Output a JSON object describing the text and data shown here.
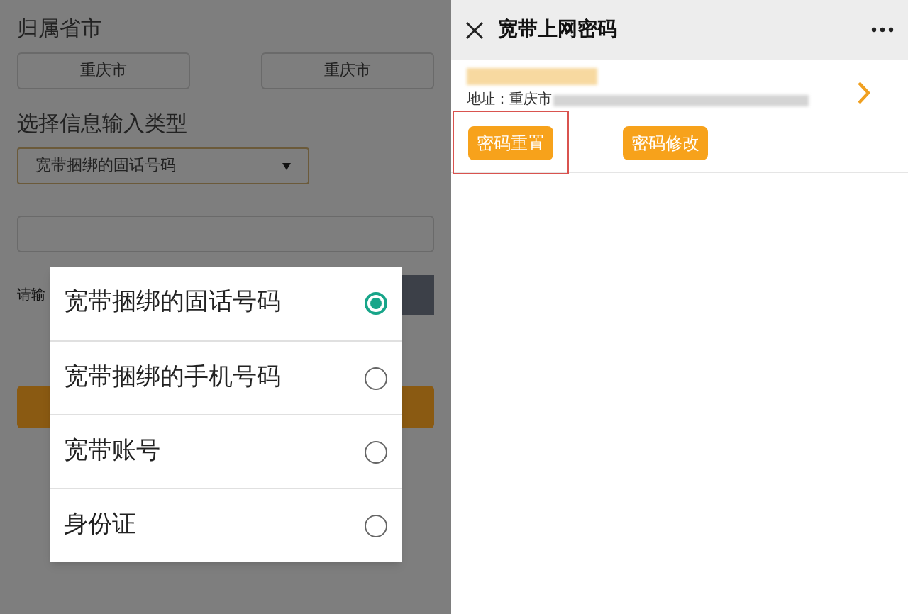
{
  "form": {
    "province_label": "归属省市",
    "province_fields": [
      "重庆市",
      "重庆市"
    ],
    "type_label": "选择信息输入类型",
    "type_select": {
      "value": "宽带捆绑的固话号码"
    },
    "captcha_label": "请输"
  },
  "dialog": {
    "options": [
      {
        "label": "宽带捆绑的固话号码",
        "selected": true
      },
      {
        "label": "宽带捆绑的手机号码",
        "selected": false
      },
      {
        "label": "宽带账号",
        "selected": false
      },
      {
        "label": "身份证",
        "selected": false
      }
    ]
  },
  "header": {
    "title": "宽带上网密码"
  },
  "account_card": {
    "address": "地址：重庆市",
    "buttons": [
      {
        "label": "密码重置",
        "highlighted": true
      },
      {
        "label": "密码修改",
        "highlighted": false
      }
    ]
  }
}
